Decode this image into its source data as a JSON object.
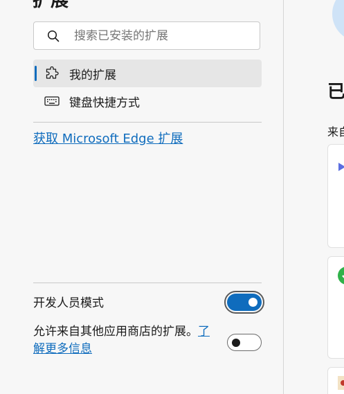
{
  "sidebar": {
    "title": "扩展",
    "search": {
      "placeholder": "搜索已安装的扩展",
      "value": ""
    },
    "nav": [
      {
        "label": "我的扩展",
        "icon": "puzzle-icon",
        "active": true
      },
      {
        "label": "键盘快捷方式",
        "icon": "keyboard-icon",
        "active": false
      }
    ],
    "store_link": "获取 Microsoft Edge 扩展",
    "developer_mode": {
      "label": "开发人员模式",
      "enabled": true
    },
    "other_stores": {
      "label": "允许来自其他应用商店的扩展。",
      "learn_more": "了解更多信息",
      "enabled": false
    }
  },
  "main": {
    "installed_title": "已",
    "from_other_sources": "来自"
  },
  "colors": {
    "accent": "#0f6cbd",
    "background": "#f7f7f7",
    "active_nav": "#e6e6e6"
  }
}
